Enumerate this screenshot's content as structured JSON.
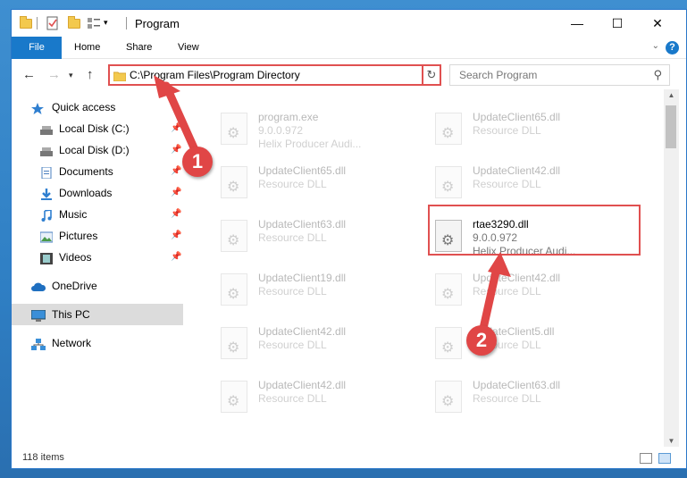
{
  "window": {
    "title": "Program",
    "controls": {
      "minimize": "—",
      "maximize": "☐",
      "close": "✕"
    }
  },
  "ribbon": {
    "tabs": [
      "File",
      "Home",
      "Share",
      "View"
    ],
    "help": "?"
  },
  "address_bar": {
    "path": "C:\\Program Files\\Program Directory",
    "search_placeholder": "Search Program"
  },
  "nav_pane": {
    "items": [
      {
        "label": "Quick access",
        "icon": "star-icon",
        "pinned": false,
        "selected": false
      },
      {
        "label": "Local Disk (C:)",
        "icon": "drive-icon",
        "pinned": true,
        "selected": false
      },
      {
        "label": "Local Disk (D:)",
        "icon": "drive-icon",
        "pinned": true,
        "selected": false
      },
      {
        "label": "Documents",
        "icon": "documents-icon",
        "pinned": true,
        "selected": false
      },
      {
        "label": "Downloads",
        "icon": "download-icon",
        "pinned": true,
        "selected": false
      },
      {
        "label": "Music",
        "icon": "music-icon",
        "pinned": true,
        "selected": false
      },
      {
        "label": "Pictures",
        "icon": "pictures-icon",
        "pinned": true,
        "selected": false
      },
      {
        "label": "Videos",
        "icon": "videos-icon",
        "pinned": true,
        "selected": false
      },
      {
        "label": "OneDrive",
        "icon": "cloud-icon",
        "pinned": false,
        "selected": false
      },
      {
        "label": "This PC",
        "icon": "computer-icon",
        "pinned": false,
        "selected": true
      },
      {
        "label": "Network",
        "icon": "network-icon",
        "pinned": false,
        "selected": false
      }
    ]
  },
  "files": [
    {
      "name": "program.exe",
      "line2": "9.0.0.972",
      "line3": "Helix Producer Audi...",
      "focus": false
    },
    {
      "name": "UpdateClient65.dll",
      "line2": "Resource DLL",
      "line3": "",
      "focus": false
    },
    {
      "name": "UpdateClient65.dll",
      "line2": "Resource DLL",
      "line3": "",
      "focus": false
    },
    {
      "name": "UpdateClient42.dll",
      "line2": "Resource DLL",
      "line3": "",
      "focus": false
    },
    {
      "name": "UpdateClient63.dll",
      "line2": "Resource DLL",
      "line3": "",
      "focus": false
    },
    {
      "name": "rtae3290.dll",
      "line2": "9.0.0.972",
      "line3": "Helix Producer Audi...",
      "focus": true
    },
    {
      "name": "UpdateClient19.dll",
      "line2": "Resource DLL",
      "line3": "",
      "focus": false
    },
    {
      "name": "UpdateClient42.dll",
      "line2": "Resource DLL",
      "line3": "",
      "focus": false
    },
    {
      "name": "UpdateClient42.dll",
      "line2": "Resource DLL",
      "line3": "",
      "focus": false
    },
    {
      "name": "UpdateClient5.dll",
      "line2": "Resource DLL",
      "line3": "",
      "focus": false
    },
    {
      "name": "UpdateClient42.dll",
      "line2": "Resource DLL",
      "line3": "",
      "focus": false
    },
    {
      "name": "UpdateClient63.dll",
      "line2": "Resource DLL",
      "line3": "",
      "focus": false
    }
  ],
  "status": {
    "item_count": "118 items"
  },
  "annotations": {
    "step1": "1",
    "step2": "2",
    "color": "#e04646"
  },
  "colors": {
    "accent": "#1979ca",
    "highlight": "#e05050"
  }
}
